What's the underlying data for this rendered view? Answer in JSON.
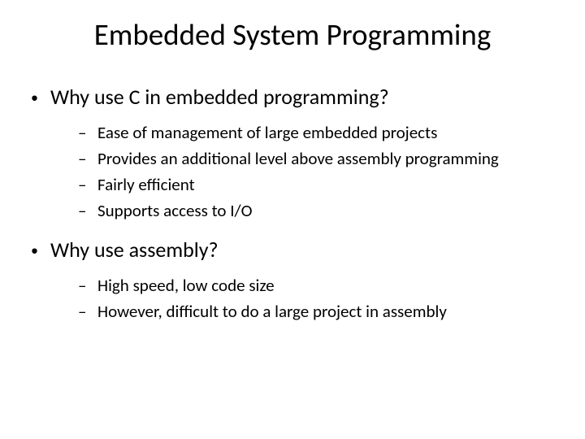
{
  "title": "Embedded System Programming",
  "section1": {
    "heading": "Why use C in embedded programming?",
    "items": [
      "Ease of management of large embedded projects",
      "Provides an additional level above assembly programming",
      "Fairly efficient",
      "Supports access to I/O"
    ]
  },
  "section2": {
    "heading": "Why use assembly?",
    "items": [
      "High speed, low code size",
      "However, difficult to do a large project in assembly"
    ]
  }
}
